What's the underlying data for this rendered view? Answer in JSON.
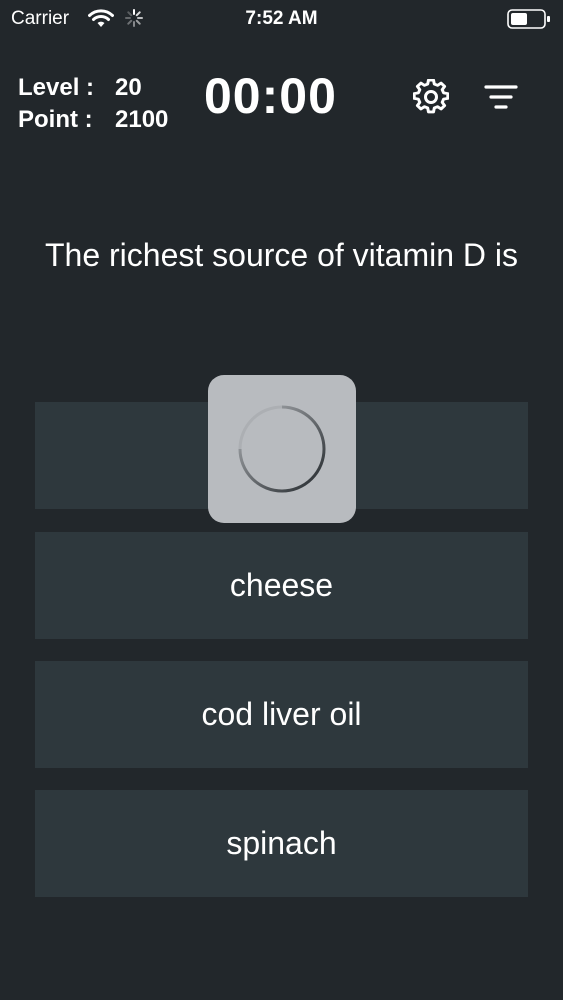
{
  "status_bar": {
    "carrier": "Carrier",
    "time": "7:52 AM",
    "icons": [
      "wifi-icon",
      "activity-icon",
      "battery-icon"
    ]
  },
  "header": {
    "level_label": "Level :",
    "level_value": "20",
    "point_label": "Point :",
    "point_value": "2100",
    "timer": "00:00",
    "settings_icon": "gear-icon",
    "filter_icon": "filter-icon"
  },
  "question": {
    "text": "The richest source of vitamin D is"
  },
  "answers": [
    {
      "label": ""
    },
    {
      "label": "cheese"
    },
    {
      "label": "cod liver oil"
    },
    {
      "label": "spinach"
    }
  ],
  "loading": {
    "icon": "spinner-icon"
  },
  "colors": {
    "background": "#22272b",
    "answer_background": "#2e383d",
    "hud_background": "#b8bbbf",
    "text": "#ffffff"
  }
}
